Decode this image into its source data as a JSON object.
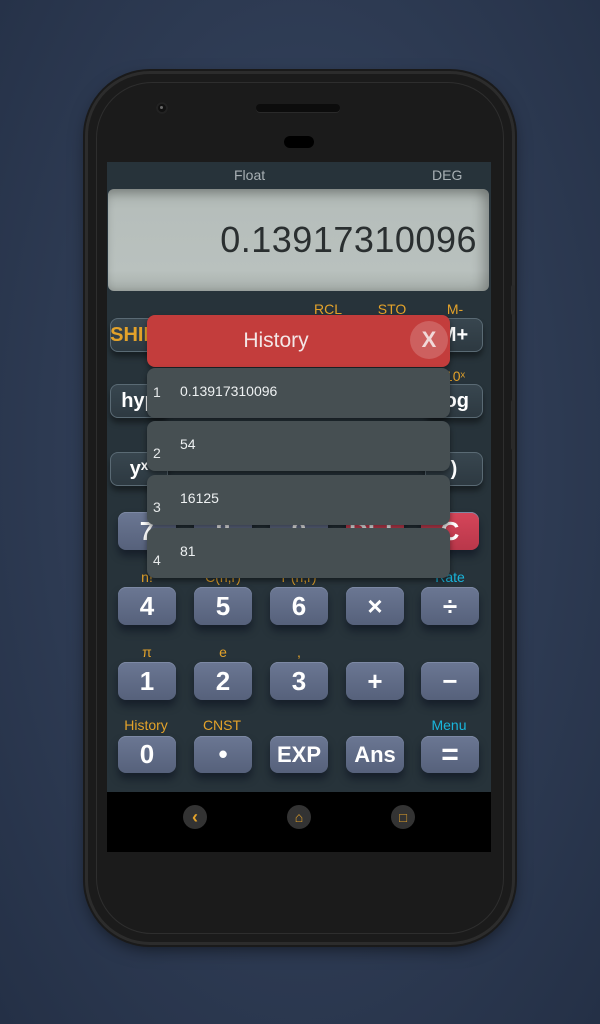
{
  "status": {
    "mode": "Float",
    "angle_unit": "DEG"
  },
  "display": {
    "value": "0.13917310096"
  },
  "keypad": {
    "row1": {
      "keys": [
        {
          "label": "SHIFT",
          "shift": ""
        },
        {
          "label": "",
          "shift": ""
        },
        {
          "label": "",
          "shift": "RCL"
        },
        {
          "label": "",
          "shift": "STO"
        },
        {
          "label": "M+",
          "shift": "M-"
        }
      ]
    },
    "row2": {
      "keys": [
        {
          "label": "hyp",
          "shift": ""
        },
        {
          "label": "",
          "shift": ""
        },
        {
          "label": "",
          "shift": ""
        },
        {
          "label": "",
          "shift": ""
        },
        {
          "label": "log",
          "shift": "10ˣ"
        }
      ]
    },
    "row3": {
      "keys": [
        {
          "label": "yˣ",
          "shift": ""
        },
        {
          "label": "",
          "shift": ""
        },
        {
          "label": "",
          "shift": ""
        },
        {
          "label": "",
          "shift": ""
        },
        {
          "label": ")",
          "shift": ""
        }
      ]
    },
    "row4": {
      "keys": [
        {
          "label": "7"
        },
        {
          "label": "8"
        },
        {
          "label": "9"
        },
        {
          "label": "DEL"
        },
        {
          "label": "C"
        }
      ]
    },
    "row5": {
      "keys": [
        {
          "label": "4",
          "shift": "n!"
        },
        {
          "label": "5",
          "shift": "C(n,r)"
        },
        {
          "label": "6",
          "shift": "P(n,r)"
        },
        {
          "label": "×",
          "shift": ""
        },
        {
          "label": "÷",
          "shift": "Rate"
        }
      ]
    },
    "row6": {
      "keys": [
        {
          "label": "1",
          "shift": "π"
        },
        {
          "label": "2",
          "shift": "e"
        },
        {
          "label": "3",
          "shift": ","
        },
        {
          "label": "+",
          "shift": ""
        },
        {
          "label": "−",
          "shift": ""
        }
      ]
    },
    "row7": {
      "keys": [
        {
          "label": "0",
          "shift": "History"
        },
        {
          "label": "•",
          "shift": "CNST"
        },
        {
          "label": "EXP",
          "shift": ""
        },
        {
          "label": "Ans",
          "shift": ""
        },
        {
          "label": "=",
          "shift": "Menu"
        }
      ]
    }
  },
  "history": {
    "title": "History",
    "close_label": "X",
    "items": [
      {
        "index": "1",
        "value": "0.13917310096"
      },
      {
        "index": "2",
        "value": "54"
      },
      {
        "index": "3",
        "value": "16125"
      },
      {
        "index": "4",
        "value": "81"
      }
    ]
  },
  "navbar": {
    "back_icon": "‹",
    "home_icon": "⌂",
    "recents_icon": "□"
  },
  "colors": {
    "accent_orange": "#e3a22a",
    "accent_cyan": "#19b6dc",
    "history_header": "#c33d3c",
    "history_item": "#464f52",
    "key_blue": "#616d88",
    "key_red": "#c8404f"
  }
}
